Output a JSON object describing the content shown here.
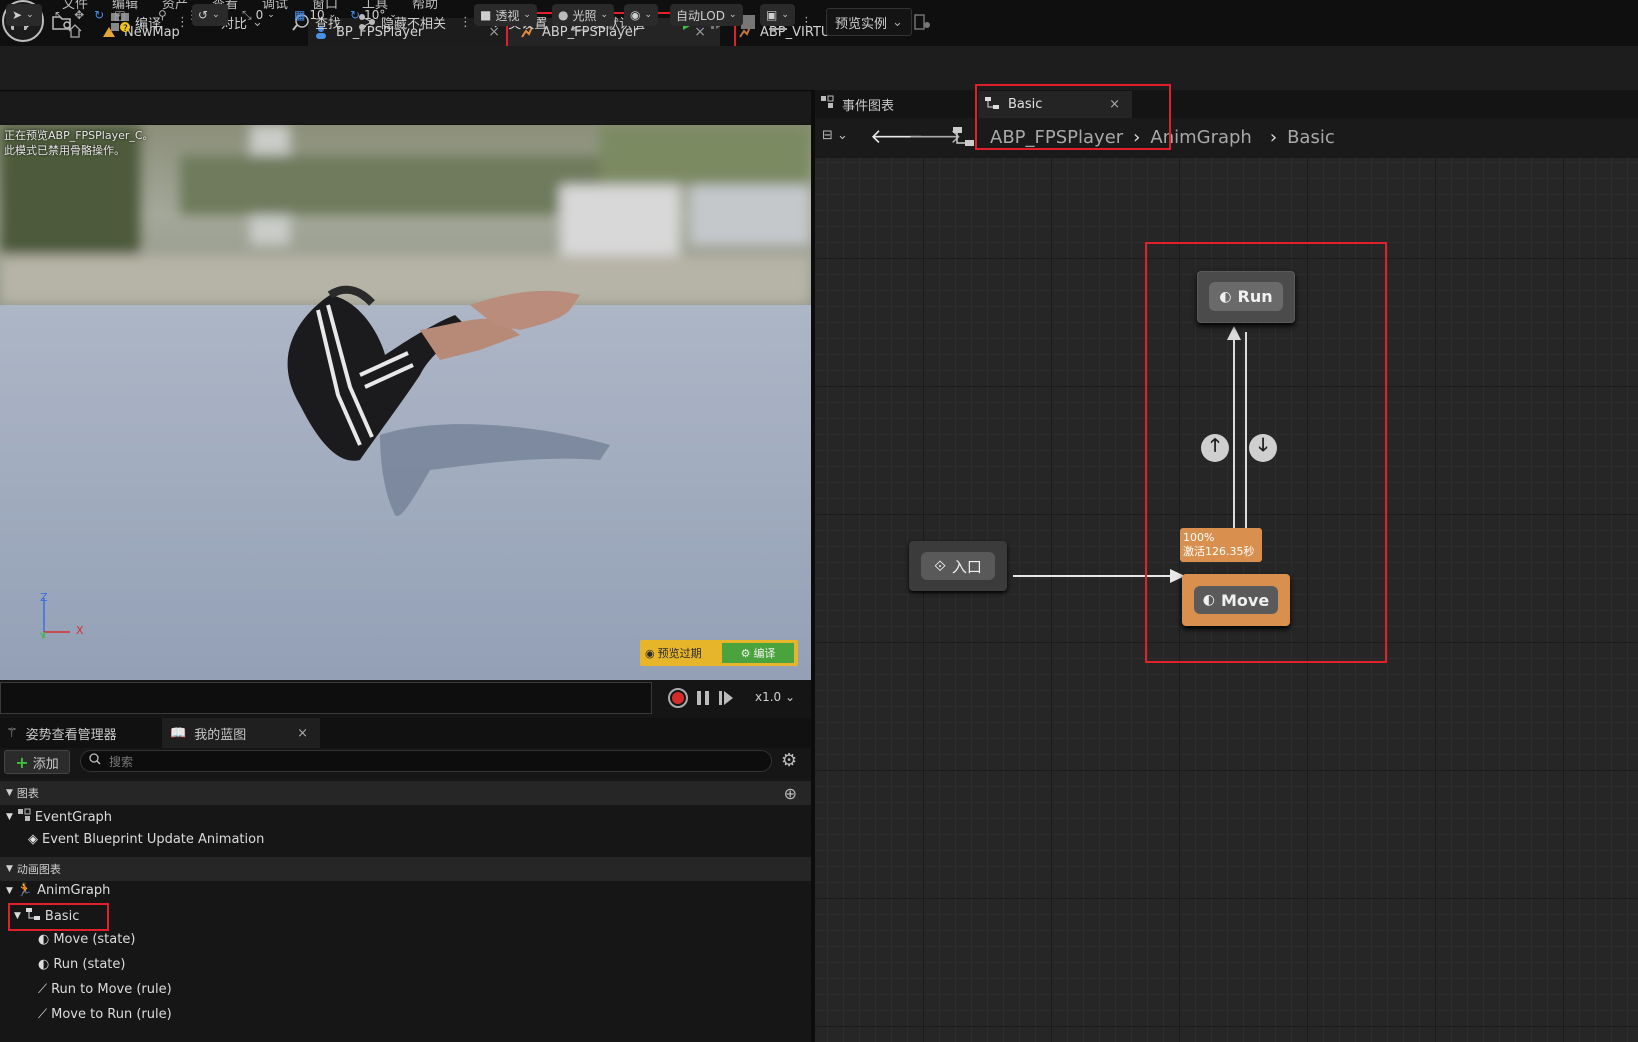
{
  "menu": [
    "文件",
    "编辑",
    "资产",
    "查看",
    "调试",
    "窗口",
    "工具",
    "帮助"
  ],
  "tabs": [
    {
      "label": "NewMap"
    },
    {
      "label": "BP_FPSPlayer",
      "close": "×"
    },
    {
      "label": "ABP_FPSPlayer",
      "close": "×"
    },
    {
      "label": "ABP_VIRTUS"
    }
  ],
  "toolbar": {
    "compile": "编译",
    "diff": "对比",
    "find": "查找",
    "hide_unrelated": "隐藏不相关",
    "class_settings": "类设置",
    "class_defaults": "类默认值",
    "preview_instance": "预览实例"
  },
  "viewport": {
    "snap_angle": "0",
    "grid": "10",
    "rotate": "10°",
    "perspective": "透视",
    "lighting": "光照",
    "lod": "自动LOD",
    "info_line1": "正在预览ABP_FPSPlayer_C。",
    "info_line2": "此模式已禁用骨骼操作。",
    "axis_z": "Z",
    "axis_x": "X",
    "axis_y": "Y",
    "badge_preview": "预览过期",
    "badge_compile": "编译",
    "speed": "x1.0"
  },
  "bottom": {
    "tab1": "姿势查看管理器",
    "tab2": "我的蓝图",
    "tab2_close": "×",
    "add": "添加",
    "search_placeholder": "搜索",
    "section_graphs": "图表",
    "eventgraph": "EventGraph",
    "event_update": "Event Blueprint Update Animation",
    "section_anim": "动画图表",
    "animgraph": "AnimGraph",
    "basic": "Basic",
    "items": [
      "Move (state)",
      "Run (state)",
      "Run to Move (rule)",
      "Move to Run (rule)"
    ]
  },
  "graph": {
    "tab_event": "事件图表",
    "tab_basic": "Basic",
    "tab_close": "×",
    "breadcrumb": [
      "ABP_FPSPlayer",
      "AnimGraph",
      "Basic"
    ],
    "entry": "入口",
    "state_run": "Run",
    "state_move": "Move",
    "active_pct": "100%",
    "active_time": "激活126.35秒"
  },
  "colors": {
    "accent_red": "#e0202a",
    "move_orange": "#d9904f",
    "play_green": "#3fbf3f"
  }
}
